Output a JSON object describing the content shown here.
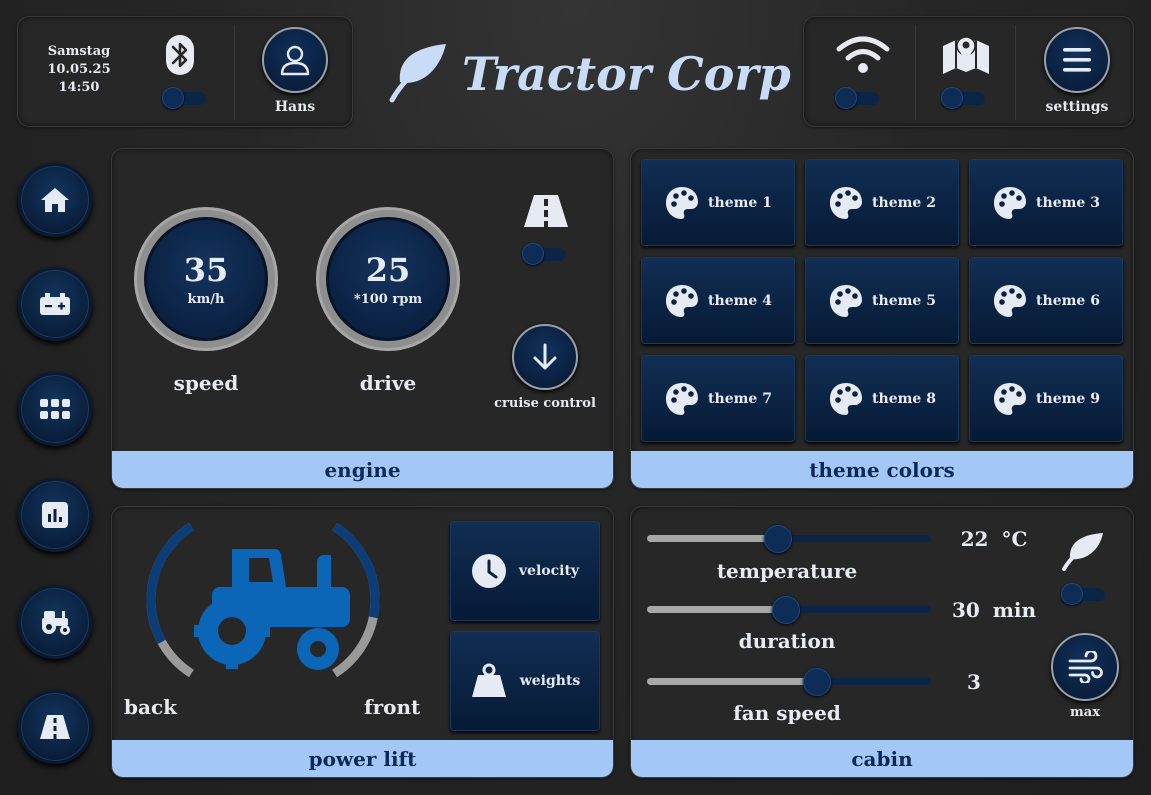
{
  "clock": {
    "day": "Samstag",
    "date": "10.05.25",
    "time": "14:50"
  },
  "user": {
    "name": "Hans"
  },
  "brand": {
    "name": "Tractor Corp"
  },
  "header": {
    "settings_label": "settings"
  },
  "toggles": {
    "bluetooth": false,
    "wifi": false,
    "map": false,
    "lane_assist": false,
    "eco": false
  },
  "engine": {
    "title": "engine",
    "speed": {
      "value": "35",
      "unit": "km/h",
      "label": "speed"
    },
    "drive": {
      "value": "25",
      "unit": "*100 rpm",
      "label": "drive"
    },
    "cruise_label": "cruise control"
  },
  "themes": {
    "title": "theme colors",
    "items": [
      "theme 1",
      "theme 2",
      "theme 3",
      "theme 4",
      "theme 5",
      "theme 6",
      "theme 7",
      "theme 8",
      "theme 9"
    ]
  },
  "power_lift": {
    "title": "power lift",
    "back_label": "back",
    "front_label": "front",
    "back_level": 0.75,
    "front_level": 0.6,
    "velocity_label": "velocity",
    "weights_label": "weights"
  },
  "cabin": {
    "title": "cabin",
    "temperature": {
      "label": "temperature",
      "value": "22",
      "unit": "°C",
      "level": 0.46
    },
    "duration": {
      "label": "duration",
      "value": "30",
      "unit": "min",
      "level": 0.49
    },
    "fan_speed": {
      "label": "fan speed",
      "value": "3",
      "unit": "",
      "level": 0.6
    },
    "max_label": "max"
  },
  "colors": {
    "accent": "#a3c8f8",
    "navy": "#0b2142",
    "tractor_blue": "#0b66b8"
  },
  "nav": [
    "home-icon",
    "battery-icon",
    "apps-icon",
    "chart-icon",
    "tractor-icon",
    "road-icon"
  ]
}
